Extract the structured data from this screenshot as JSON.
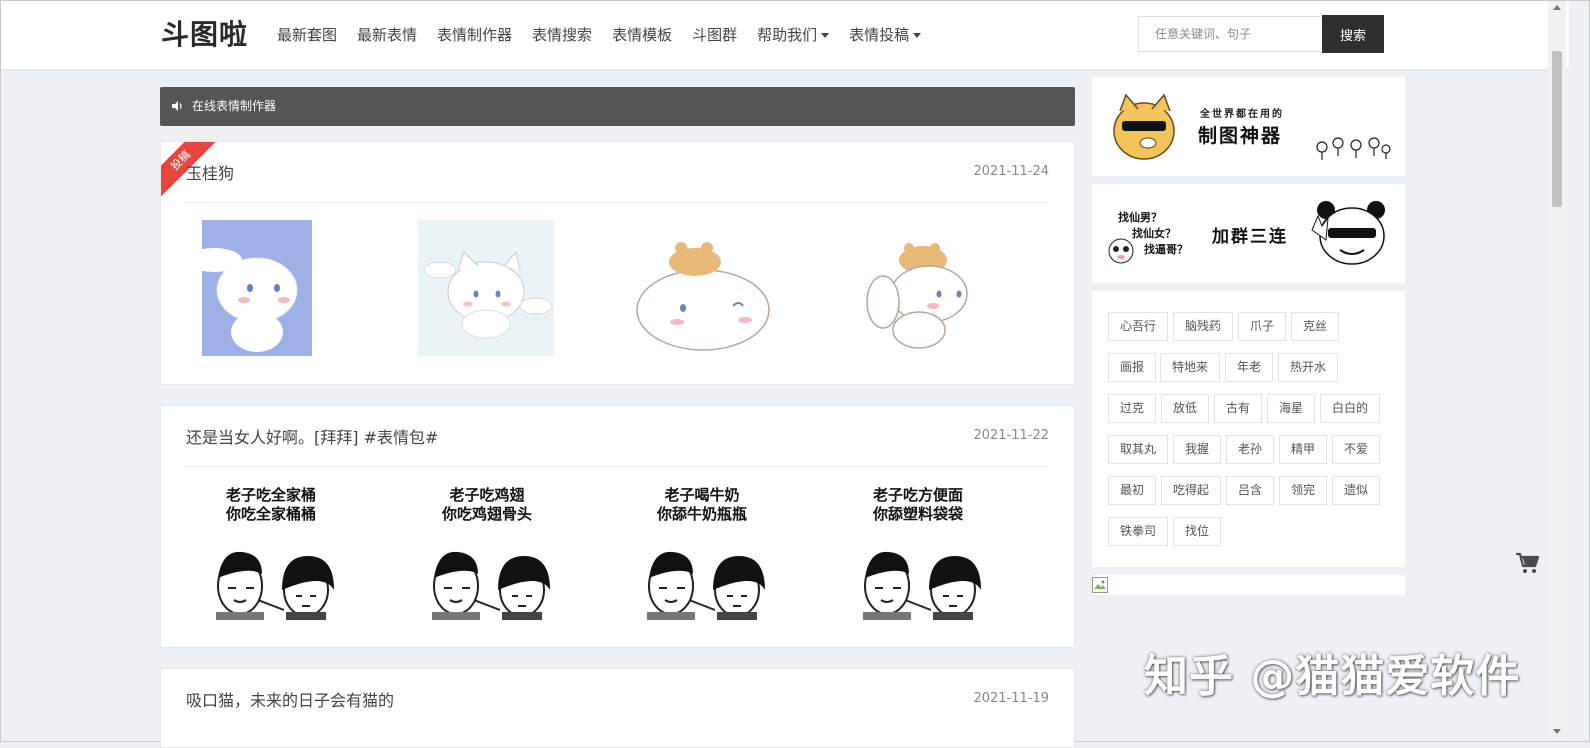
{
  "header": {
    "logo": "斗图啦",
    "nav": [
      "最新套图",
      "最新表情",
      "表情制作器",
      "表情搜索",
      "表情模板",
      "斗图群",
      "帮助我们",
      "表情投稿"
    ],
    "search_placeholder": "任意关键词、句子",
    "search_button": "搜索"
  },
  "notice": {
    "text": "在线表情制作器"
  },
  "posts": [
    {
      "badge": "投稿",
      "title": "玉桂狗",
      "date": "2021-11-24"
    },
    {
      "title": "还是当女人好啊。[拜拜] #表情包#",
      "date": "2021-11-22",
      "memes": [
        [
          "老子吃全家桶",
          "你吃全家桶桶"
        ],
        [
          "老子吃鸡翅",
          "你吃鸡翅骨头"
        ],
        [
          "老子喝牛奶",
          "你舔牛奶瓶瓶"
        ],
        [
          "老子吃方便面",
          "你舔塑料袋袋"
        ]
      ]
    },
    {
      "title": "吸口猫，未来的日子会有猫的",
      "date": "2021-11-19"
    }
  ],
  "sidebar": {
    "banner1": {
      "small": "全世界都在用的",
      "big": "制图神器"
    },
    "banner2": {
      "lines": [
        "找仙男？",
        "找仙女？",
        "找逼哥？"
      ],
      "big": "加群三连"
    },
    "tags": [
      "心吾行",
      "脑残药",
      "爪子",
      "克丝",
      "画报",
      "特地来",
      "年老",
      "热开水",
      "过克",
      "放低",
      "古有",
      "海星",
      "白白的",
      "取其丸",
      "我握",
      "老孙",
      "精甲",
      "不爱",
      "最初",
      "吃得起",
      "吕含",
      "领完",
      "遗似",
      "铁拳司",
      "找位"
    ]
  },
  "watermark": "知乎 @猫猫爱软件",
  "colors": {
    "notice_bg": "#555555",
    "ribbon": "#e8453c",
    "page_bg": "#eef1f3",
    "search_btn": "#2f2f2f"
  }
}
